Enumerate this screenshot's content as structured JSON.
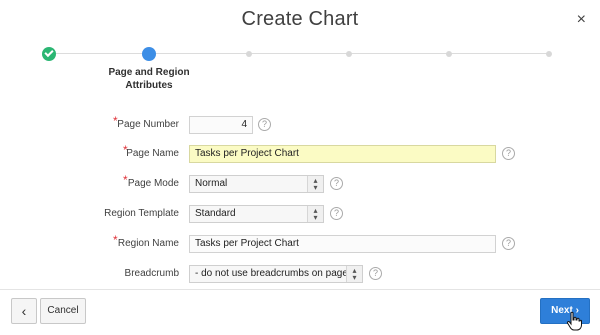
{
  "dialog": {
    "title": "Create Chart",
    "close_glyph": "×"
  },
  "wizard": {
    "steps": [
      {
        "state": "done",
        "label": ""
      },
      {
        "state": "current",
        "label": "Page and Region Attributes"
      },
      {
        "state": "future",
        "label": ""
      },
      {
        "state": "future",
        "label": ""
      },
      {
        "state": "future",
        "label": ""
      },
      {
        "state": "future",
        "label": ""
      }
    ],
    "current_label_line1": "Page and Region",
    "current_label_line2": "Attributes",
    "colors": {
      "done": "#2bb673",
      "current": "#3d8ee6",
      "future": "#d8d8d8"
    }
  },
  "form": {
    "page_number": {
      "label": "Page Number",
      "value": "4",
      "required": true
    },
    "page_name": {
      "label": "Page Name",
      "value": "Tasks per Project Chart",
      "required": true
    },
    "page_mode": {
      "label": "Page Mode",
      "value": "Normal",
      "required": true
    },
    "region_template": {
      "label": "Region Template",
      "value": "Standard",
      "required": false
    },
    "region_name": {
      "label": "Region Name",
      "value": "Tasks per Project Chart",
      "required": true
    },
    "breadcrumb": {
      "label": "Breadcrumb",
      "value": "- do not use breadcrumbs on page -",
      "required": false
    },
    "required_marker": "*",
    "help_glyph": "?"
  },
  "footer": {
    "back_glyph": "‹",
    "cancel_label": "Cancel",
    "next_label": "Next",
    "next_glyph": "›"
  }
}
